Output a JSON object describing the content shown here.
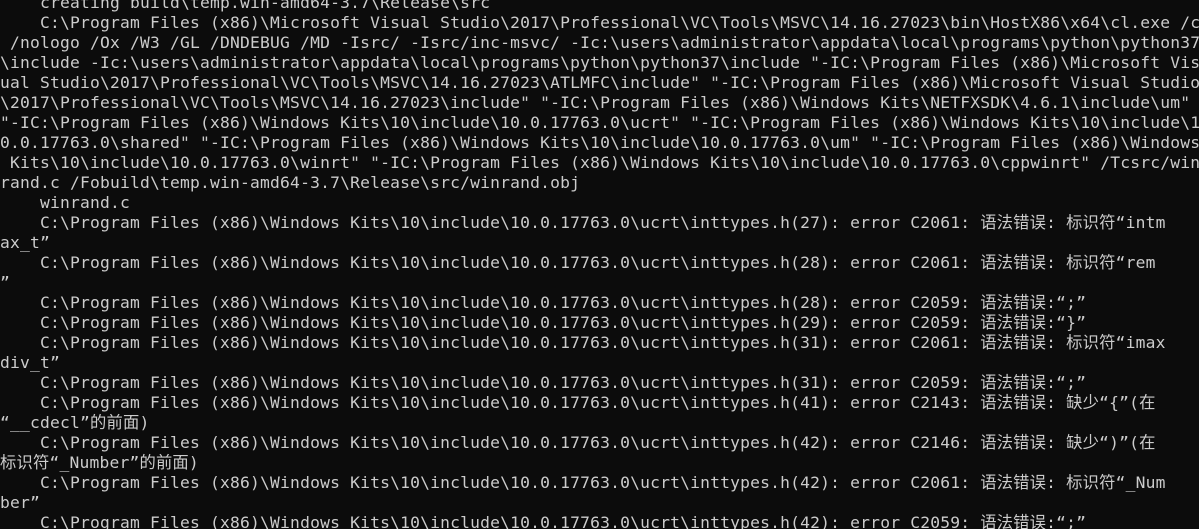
{
  "console": {
    "lines": [
      "    creating build\\temp.win-amd64-3.7\\Release\\src",
      "    C:\\Program Files (x86)\\Microsoft Visual Studio\\2017\\Professional\\VC\\Tools\\MSVC\\14.16.27023\\bin\\HostX86\\x64\\cl.exe /c",
      " /nologo /Ox /W3 /GL /DNDEBUG /MD -Isrc/ -Isrc/inc-msvc/ -Ic:\\users\\administrator\\appdata\\local\\programs\\python\\python37",
      "\\include -Ic:\\users\\administrator\\appdata\\local\\programs\\python\\python37\\include \"-IC:\\Program Files (x86)\\Microsoft Vis",
      "ual Studio\\2017\\Professional\\VC\\Tools\\MSVC\\14.16.27023\\ATLMFC\\include\" \"-IC:\\Program Files (x86)\\Microsoft Visual Studio",
      "\\2017\\Professional\\VC\\Tools\\MSVC\\14.16.27023\\include\" \"-IC:\\Program Files (x86)\\Windows Kits\\NETFXSDK\\4.6.1\\include\\um\"",
      "\"-IC:\\Program Files (x86)\\Windows Kits\\10\\include\\10.0.17763.0\\ucrt\" \"-IC:\\Program Files (x86)\\Windows Kits\\10\\include\\1",
      "0.0.17763.0\\shared\" \"-IC:\\Program Files (x86)\\Windows Kits\\10\\include\\10.0.17763.0\\um\" \"-IC:\\Program Files (x86)\\Windows",
      " Kits\\10\\include\\10.0.17763.0\\winrt\" \"-IC:\\Program Files (x86)\\Windows Kits\\10\\include\\10.0.17763.0\\cppwinrt\" /Tcsrc/win",
      "rand.c /Fobuild\\temp.win-amd64-3.7\\Release\\src/winrand.obj",
      "    winrand.c",
      "    C:\\Program Files (x86)\\Windows Kits\\10\\include\\10.0.17763.0\\ucrt\\inttypes.h(27): error C2061: 语法错误: 标识符“intm",
      "ax_t”",
      "    C:\\Program Files (x86)\\Windows Kits\\10\\include\\10.0.17763.0\\ucrt\\inttypes.h(28): error C2061: 语法错误: 标识符“rem",
      "”",
      "    C:\\Program Files (x86)\\Windows Kits\\10\\include\\10.0.17763.0\\ucrt\\inttypes.h(28): error C2059: 语法错误:“;”",
      "    C:\\Program Files (x86)\\Windows Kits\\10\\include\\10.0.17763.0\\ucrt\\inttypes.h(29): error C2059: 语法错误:“}”",
      "    C:\\Program Files (x86)\\Windows Kits\\10\\include\\10.0.17763.0\\ucrt\\inttypes.h(31): error C2061: 语法错误: 标识符“imax",
      "div_t”",
      "    C:\\Program Files (x86)\\Windows Kits\\10\\include\\10.0.17763.0\\ucrt\\inttypes.h(31): error C2059: 语法错误:“;”",
      "    C:\\Program Files (x86)\\Windows Kits\\10\\include\\10.0.17763.0\\ucrt\\inttypes.h(41): error C2143: 语法错误: 缺少“{”(在",
      "“__cdecl”的前面)",
      "    C:\\Program Files (x86)\\Windows Kits\\10\\include\\10.0.17763.0\\ucrt\\inttypes.h(42): error C2146: 语法错误: 缺少“)”(在",
      "标识符“_Number”的前面)",
      "    C:\\Program Files (x86)\\Windows Kits\\10\\include\\10.0.17763.0\\ucrt\\inttypes.h(42): error C2061: 语法错误: 标识符“_Num",
      "ber”",
      "    C:\\Program Files (x86)\\Windows Kits\\10\\include\\10.0.17763.0\\ucrt\\inttypes.h(42): error C2059: 语法错误:“;”"
    ]
  }
}
